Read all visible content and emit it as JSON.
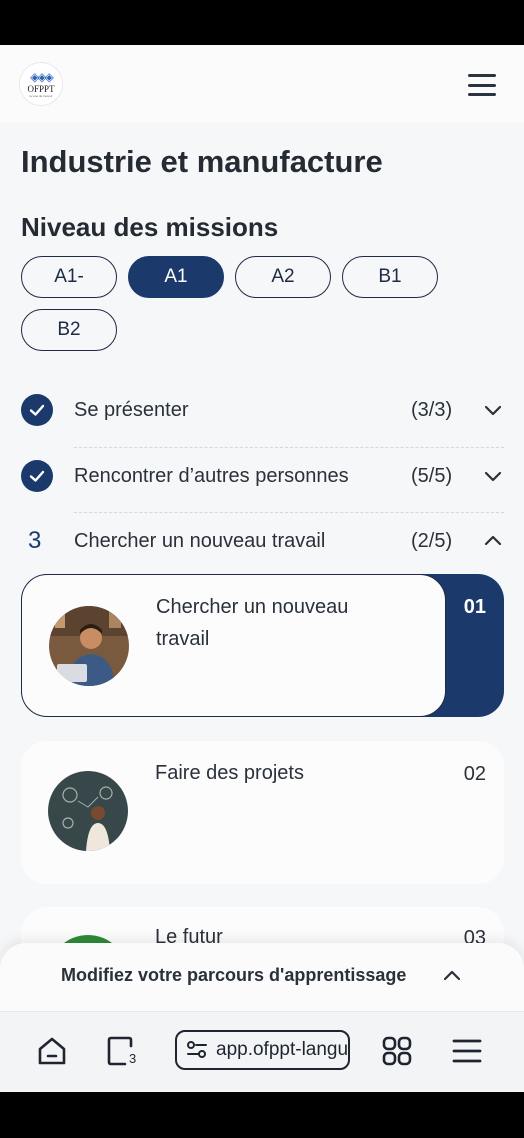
{
  "header": {
    "logo_text": "OFPPT",
    "logo_sub": "la voie de l'avenir",
    "menu_icon": "hamburger-menu-icon"
  },
  "page_title": "Industrie et manufacture",
  "levels_section": {
    "title": "Niveau des missions",
    "levels": [
      "A1-",
      "A1",
      "A2",
      "B1",
      "B2"
    ],
    "active": "A1"
  },
  "missions": [
    {
      "status": "completed",
      "label": "Se présenter",
      "count": "(3/3)",
      "expanded": false
    },
    {
      "status": "completed",
      "label": "Rencontrer d’autres personnes",
      "count": "(5/5)",
      "expanded": false
    },
    {
      "status": "current",
      "number": "3",
      "label": "Chercher un nouveau travail",
      "count": "(2/5)",
      "expanded": true
    }
  ],
  "lessons": [
    {
      "title": "Chercher un nouveau travail",
      "number": "01",
      "active": true
    },
    {
      "title": "Faire des projets",
      "number": "02",
      "active": false
    },
    {
      "title": "Le futur",
      "number": "03",
      "active": false
    }
  ],
  "drawer": {
    "label": "Modifiez votre parcours d'apprentissage"
  },
  "browser": {
    "url": "app.ofppt-langues.ma",
    "tab_count": "3"
  },
  "colors": {
    "accent": "#1b3a6b",
    "background": "#f6f7f9"
  }
}
